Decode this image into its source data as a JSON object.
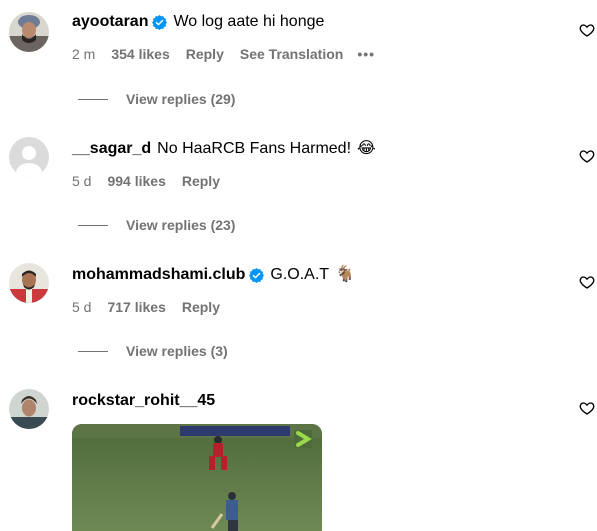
{
  "comments": [
    {
      "username": "ayootaran",
      "verified": true,
      "text": "Wo log aate hi honge",
      "time": "2 m",
      "likes": "354 likes",
      "reply": "Reply",
      "translation": "See Translation",
      "more": "•••",
      "view_replies": "View replies (29)"
    },
    {
      "username": "__sagar_d",
      "verified": false,
      "text": "No HaaRCB Fans Harmed!",
      "emoji": "😂",
      "time": "5 d",
      "likes": "994 likes",
      "reply": "Reply",
      "view_replies": "View replies (23)"
    },
    {
      "username": "mohammadshami.club",
      "verified": true,
      "text": "G.O.A.T",
      "emoji": "🐐",
      "time": "5 d",
      "likes": "717 likes",
      "reply": "Reply",
      "view_replies": "View replies (3)"
    },
    {
      "username": "rockstar_rohit__45",
      "verified": false
    }
  ],
  "colors": {
    "secondary_text": "#737373",
    "verified_blue": "#0095f6"
  },
  "icons": {
    "like": "heart-outline-icon",
    "verified": "verified-badge-icon",
    "more": "more-options-icon"
  }
}
